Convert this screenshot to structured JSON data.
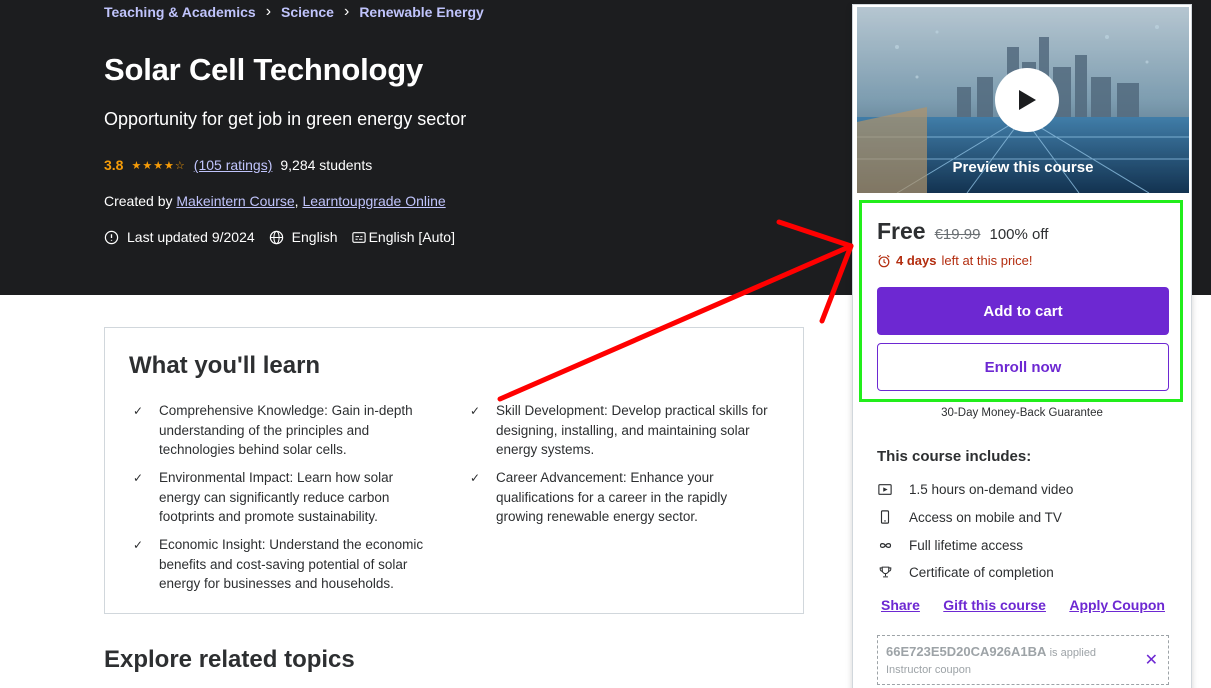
{
  "breadcrumb": [
    "Teaching & Academics",
    "Science",
    "Renewable Energy"
  ],
  "course": {
    "title": "Solar Cell Technology",
    "subtitle": "Opportunity for get job in green energy sector",
    "rating": "3.8",
    "rating_value": 3.8,
    "ratings_count": "(105 ratings)",
    "students": "9,284 students",
    "created_by_label": "Created by",
    "instructors": [
      "Makeintern Course",
      "Learntoupgrade Online"
    ],
    "instructor_sep": ",",
    "last_updated": "Last updated 9/2024",
    "language": "English",
    "captions": "English [Auto]"
  },
  "learn": {
    "title": "What you'll learn",
    "items": [
      "Comprehensive Knowledge: Gain in-depth understanding of the principles and technologies behind solar cells.",
      "Skill Development: Develop practical skills for designing, installing, and maintaining solar energy systems.",
      "Environmental Impact: Learn how solar energy can significantly reduce carbon footprints and promote sustainability.",
      "Career Advancement: Enhance your qualifications for a career in the rapidly growing renewable energy sector.",
      "Economic Insight: Understand the economic benefits and cost-saving potential of solar energy for businesses and households."
    ]
  },
  "explore_title": "Explore related topics",
  "sidebar": {
    "preview_label": "Preview this course",
    "price": "Free",
    "original_price": "€19.99",
    "discount": "100% off",
    "timer_bold": "4 days",
    "timer_rest": "left at this price!",
    "add_to_cart": "Add to cart",
    "enroll_now": "Enroll now",
    "guarantee": "30-Day Money-Back Guarantee",
    "includes_title": "This course includes:",
    "includes": [
      {
        "icon": "video-icon",
        "text": "1.5 hours on-demand video"
      },
      {
        "icon": "mobile-icon",
        "text": "Access on mobile and TV"
      },
      {
        "icon": "infinity-icon",
        "text": "Full lifetime access"
      },
      {
        "icon": "trophy-icon",
        "text": "Certificate of completion"
      }
    ],
    "links": {
      "share": "Share",
      "gift": "Gift this course",
      "coupon": "Apply Coupon"
    },
    "coupon": {
      "code": "66E723E5D20CA926A1BA",
      "applied": "is applied",
      "type": "Instructor coupon"
    }
  },
  "colors": {
    "hero_bg": "#1c1d1f",
    "link_purple": "#c0c4fc",
    "brand_purple": "#6d28d2",
    "star": "#f69c08",
    "timer_red": "#b32d0f",
    "annotation_green": "#22ee1b",
    "annotation_red": "#ff0000"
  }
}
